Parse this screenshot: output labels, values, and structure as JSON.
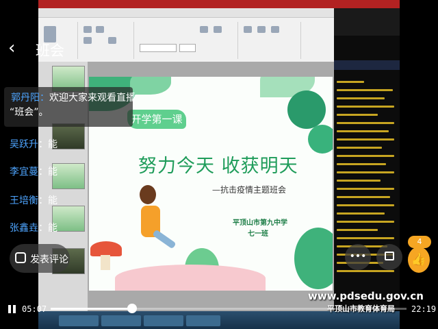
{
  "header": {
    "back_icon": "chevron-left-icon",
    "title": "班会"
  },
  "welcome": {
    "name": "郭丹阳：",
    "message_line1": "欢迎大家来观看直播",
    "message_line2": "“班会”。"
  },
  "comments": [
    {
      "name": "吴跃升",
      "text": "：能"
    },
    {
      "name": "李宜蔓",
      "text": "：能"
    },
    {
      "name": "王培衡",
      "text": "：能"
    },
    {
      "name": "张鑫垚",
      "text": "：能"
    }
  ],
  "comment_button": {
    "icon": "comment-icon",
    "label": "发表评论"
  },
  "actions": {
    "more_label": "•••",
    "cast_icon": "cast-icon",
    "like_icon": "thumbs-up-icon",
    "like_count": "4"
  },
  "slide": {
    "tag": "开学第一课",
    "title": "努力今天  收获明天",
    "subtitle": "—抗击疫情主题班会",
    "school": "平顶山市第九中学",
    "class_name": "七一班"
  },
  "watermark": {
    "url": "www.pdsedu.gov.cn",
    "org": "平顶山市教育体育局"
  },
  "player": {
    "pause_icon": "pause-icon",
    "current_time": "05:07",
    "total_time": "22:19",
    "progress": 0.229
  },
  "colors": {
    "accent_blue": "#4ea5ff",
    "like_orange": "#f6a623",
    "slide_green": "#1f9c5a"
  }
}
